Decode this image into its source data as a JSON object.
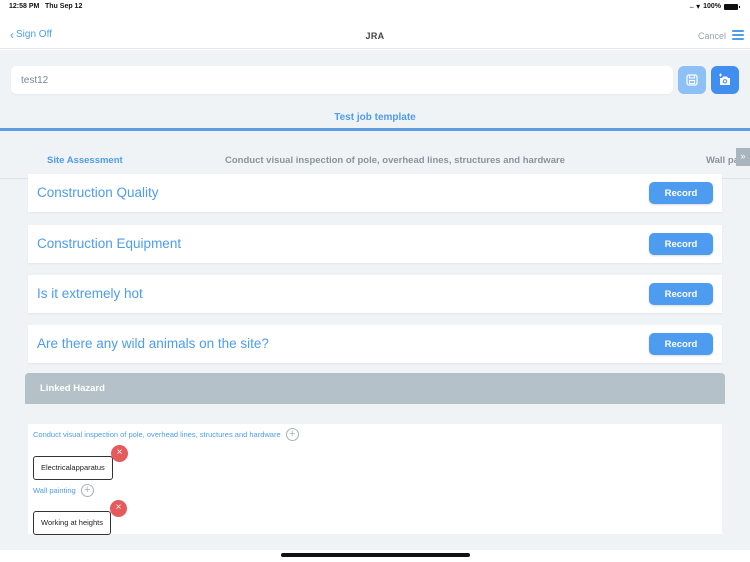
{
  "status_bar": {
    "time": "12:58 PM",
    "date": "Thu Sep 12",
    "signal": "....",
    "battery": "100%"
  },
  "nav": {
    "back_label": "Sign Off",
    "title": "JRA",
    "cancel_label": "Cancel"
  },
  "form": {
    "name_value": "test12",
    "template_title": "Test job template"
  },
  "tabs": [
    {
      "label": "Site Assessment",
      "active": true
    },
    {
      "label": "Conduct visual inspection of pole, overhead lines, structures and hardware",
      "active": false
    },
    {
      "label": "Wall painting",
      "active": false
    }
  ],
  "tab_scroll_glyph": "»",
  "questions": [
    {
      "text": "Construction Quality",
      "button": "Record"
    },
    {
      "text": "Construction Equipment",
      "button": "Record"
    },
    {
      "text": "Is it extremely hot",
      "button": "Record"
    },
    {
      "text": "Are there any wild animals on the site?",
      "button": "Record"
    }
  ],
  "linked_hazard": {
    "header": "Linked Hazard",
    "sections": [
      {
        "title": "Conduct visual inspection of pole, overhead lines, structures and hardware",
        "hazards": [
          "Electricalapparatus"
        ]
      },
      {
        "title": "Wall painting",
        "hazards": [
          "Working at heights"
        ]
      }
    ]
  },
  "icons": {
    "plus": "+",
    "remove": "×"
  },
  "colors": {
    "accent": "#4d9cf0",
    "save_button": "#8cc0f7",
    "camera_button": "#3f8ef0",
    "hazard_header": "#b4c1c9",
    "remove_badge": "#e55a5a"
  }
}
